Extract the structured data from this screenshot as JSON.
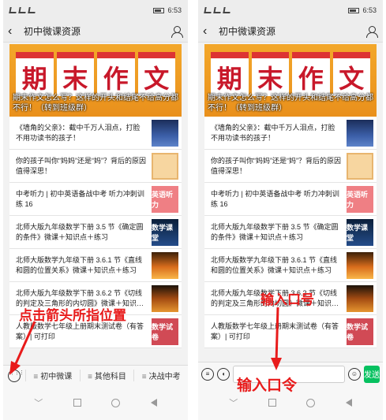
{
  "status": {
    "time": "6:53"
  },
  "nav": {
    "title": "初中微课资源"
  },
  "banner": {
    "chars": [
      "期",
      "末",
      "作",
      "文"
    ],
    "caption": "期末作文怎么写？这样的开头和结尾不给高分都不行！（转到班级群）"
  },
  "items": [
    {
      "text": "《墙角的父亲》：截中千万人泪点，打脸不用功读书的孩子！",
      "thumb": "night-icon",
      "thumb_text": ""
    },
    {
      "text": "你的孩子叫你“妈妈”还是“妈”？背后的原因值得深思！",
      "thumb": "cartoon-icon",
      "thumb_text": ""
    },
    {
      "text": "中考听力 | 初中英语备战中考 听力冲刺训练 16",
      "thumb": "listen-icon",
      "thumb_text": "英语听力"
    },
    {
      "text": "北师大版九年级数学下册 3.5 节《确定圆的条件》微课＋知识点＋练习",
      "thumb": "math-icon",
      "thumb_text": "数学课堂"
    },
    {
      "text": "北师大版数学九年级下册 3.6.1 节《直线和圆的位置关系》微课＋知识点＋练习",
      "thumb": "sunset-icon",
      "thumb_text": ""
    },
    {
      "text": "北师大版九年级数学下册 3.6.2 节《切线的判定及三角形的内切圆》微课＋知识…",
      "thumb": "sunset-icon",
      "thumb_text": ""
    },
    {
      "text": "人教版数学七年级上册期末测试卷（有答案）| 可打印",
      "thumb": "exam-icon",
      "thumb_text": "数学试卷"
    }
  ],
  "toolbar": {
    "menus": [
      "初中微课",
      "其他科目",
      "决战中考"
    ]
  },
  "inputbar": {
    "send_label": "发送"
  },
  "annotations": {
    "left": "点击箭头所指位置",
    "right_top": "输入口号",
    "right_bottom": "输入口令"
  },
  "colors": {
    "accent_green": "#07c160",
    "annotation_red": "#e81b1b",
    "banner_orange": "#f3a72a"
  }
}
